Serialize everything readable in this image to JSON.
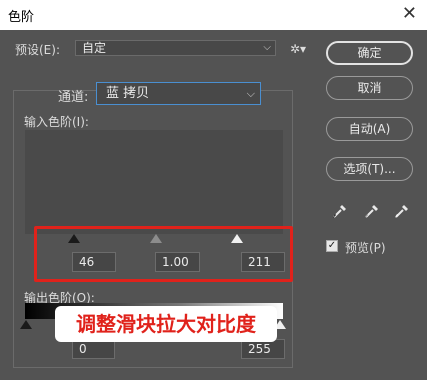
{
  "window": {
    "title": "色阶",
    "close_glyph": "✕"
  },
  "preset": {
    "label": "预设(E):",
    "value": "自定"
  },
  "channel": {
    "label": "通道:",
    "value": "蓝 拷贝"
  },
  "input_levels": {
    "label": "输入色阶(I):",
    "black": "46",
    "gamma": "1.00",
    "white": "211"
  },
  "output_levels": {
    "label": "输出色阶(O):",
    "black": "0",
    "white": "255"
  },
  "buttons": {
    "ok": "确定",
    "cancel": "取消",
    "auto": "自动(A)",
    "options": "选项(T)..."
  },
  "preview": {
    "label": "预览(P)",
    "checked": true
  },
  "annotation": {
    "text": "调整滑块拉大对比度",
    "color": "#e0221b"
  },
  "colors": {
    "dialog_bg": "#535353",
    "highlight": "#e0221b",
    "focus_border": "#4a8fd1"
  }
}
